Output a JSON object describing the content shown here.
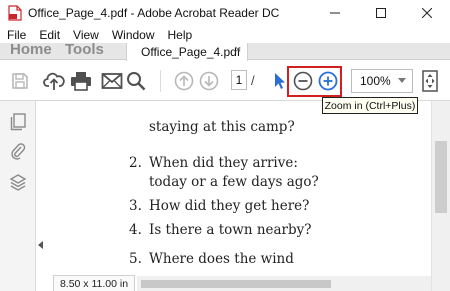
{
  "window": {
    "title": "Office_Page_4.pdf - Adobe Acrobat Reader DC",
    "minimize_glyph": "—",
    "maximize_glyph": "☐",
    "close_glyph": "✕"
  },
  "menu": [
    "File",
    "Edit",
    "View",
    "Window",
    "Help"
  ],
  "nav": {
    "home": "Home",
    "tools": "Tools",
    "doc_tab": "Office_Page_4.pdf",
    "doc_tab_close": "×"
  },
  "toolbar": {
    "icons": [
      "save-icon",
      "cloud-upload-icon",
      "print-icon",
      "email-icon",
      "search-icon",
      "previous-page-icon",
      "next-page-icon",
      "select-pointer-icon",
      "zoom-out-icon",
      "zoom-in-icon",
      "zoom-dropdown",
      "fit-page-icon"
    ],
    "page_number": "1",
    "page_separator": "/",
    "zoom_value": "100%"
  },
  "tooltip": "Zoom in (Ctrl+Plus)",
  "colors": {
    "accent_blue": "#2b6fd6",
    "highlight_red": "#d21f1f",
    "disabled_gray": "#b8b8b8"
  },
  "document": {
    "lines": [
      {
        "num": "",
        "text": "staying at this camp?"
      },
      {
        "num": "2.",
        "text": "When did they arrive:"
      },
      {
        "num": "",
        "text": "today or a few days ago?"
      },
      {
        "num": "3.",
        "text": "How did they get here?"
      },
      {
        "num": "4.",
        "text": "Is there a town nearby?"
      },
      {
        "num": "5.",
        "text": "Where does the wind"
      }
    ]
  },
  "status": {
    "page_size": "8.50 x 11.00 in"
  }
}
